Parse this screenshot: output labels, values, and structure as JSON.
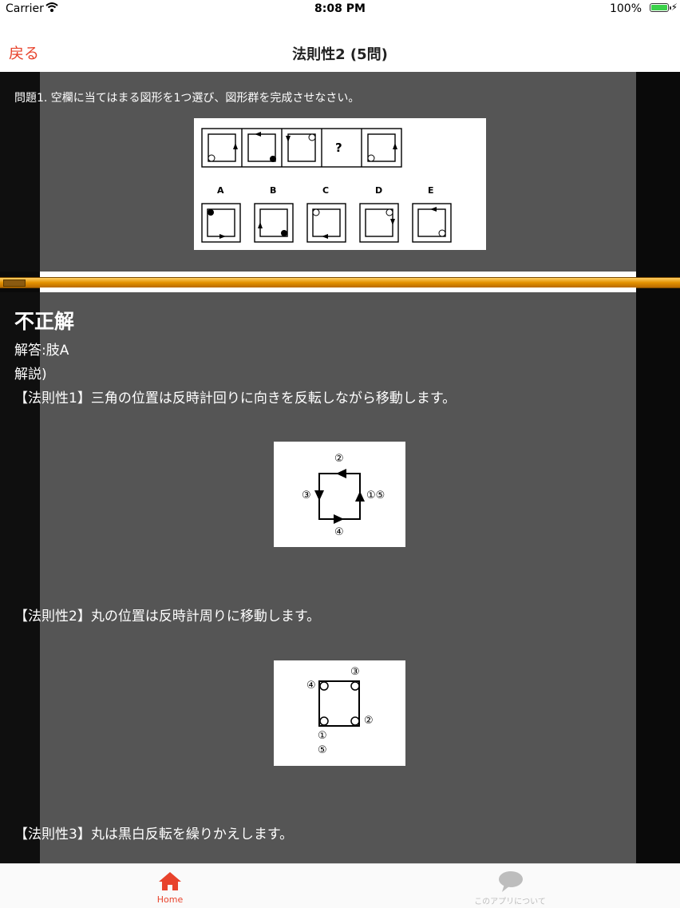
{
  "status_bar": {
    "carrier": "Carrier",
    "time": "8:08 PM",
    "battery": "100%"
  },
  "nav": {
    "back_label": "戻る",
    "title": "法則性2 (5問)"
  },
  "question": {
    "text": "問題1. 空欄に当てはまる図形を1つ選び、図形群を完成させなさい。",
    "sequence_mark": "?",
    "choices": [
      "A",
      "B",
      "C",
      "D",
      "E"
    ]
  },
  "answer": {
    "result": "不正解",
    "answer_line": "解答:肢A",
    "explanation_label": "解説)",
    "rule1": "【法則性1】三角の位置は反時計回りに向きを反転しながら移動します。",
    "rule1_figure_labels": [
      "②",
      "③",
      "①⑤",
      "④"
    ],
    "rule2": "【法則性2】丸の位置は反時計周りに移動します。",
    "rule2_figure_labels": [
      "③",
      "④",
      "②",
      "①",
      "⑤"
    ],
    "rule3": "【法則性3】丸は黒白反転を繰りかえします。"
  },
  "tabbar": {
    "home_label": "Home",
    "about_label": "このアプリについて",
    "active_color": "#e8432c",
    "inactive_color": "#bdbdbd"
  }
}
